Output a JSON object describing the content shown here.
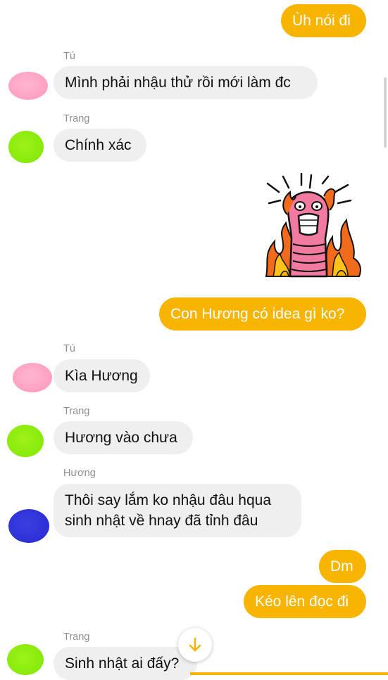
{
  "messages": [
    {
      "text": "Ùh nói đi"
    },
    {
      "sender": "Tú",
      "text": "Mình phải nhậu thử rồi mới làm đc"
    },
    {
      "sender": "Trang",
      "text": "Chính xác"
    },
    {
      "sticker": "flame-worm-sticker"
    },
    {
      "text": "Con Hương có idea gì ko?"
    },
    {
      "sender": "Tú",
      "text": "Kìa Hương"
    },
    {
      "sender": "Trang",
      "text": "Hương vào chưa"
    },
    {
      "sender": "Hương",
      "lines": [
        "Thôi say lắm ko nhậu đâu hqua",
        "sinh nhật về hnay đã tỉnh đâu"
      ]
    },
    {
      "text": "Dm"
    },
    {
      "text": "Kéo lên đọc đi"
    },
    {
      "sender": "Trang",
      "text": "Sinh nhật ai đấy?"
    }
  ],
  "colors": {
    "outgoing_bubble": "#f7b400",
    "incoming_bubble": "#efefef",
    "avatar_tu": "#ff9fc3",
    "avatar_trang": "#88ea0a",
    "avatar_huong": "#2c30d6"
  },
  "icons": {
    "scroll_down": "arrow-down-icon"
  }
}
